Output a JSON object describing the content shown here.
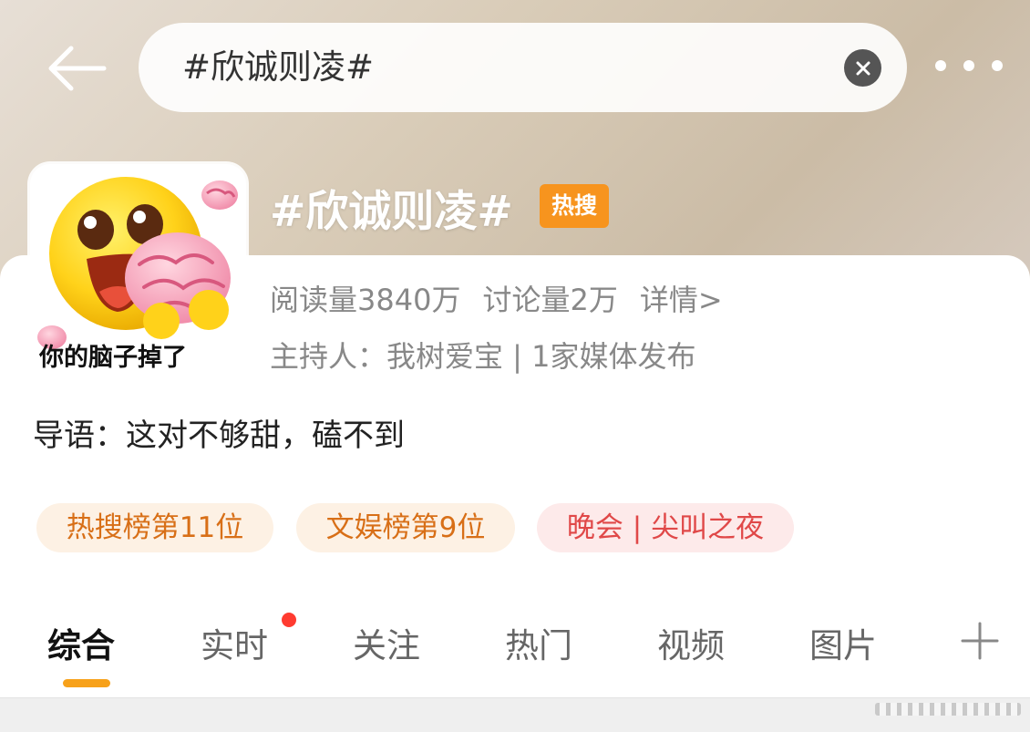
{
  "header": {
    "search_text": "#欣诚则凌#"
  },
  "topic": {
    "title": "#欣诚则凌#",
    "badge": "热搜",
    "reads": "阅读量3840万",
    "discussions": "讨论量2万",
    "details": "详情>",
    "host": "主持人：我树爱宝 | 1家媒体发布",
    "intro": "导语：这对不够甜，磕不到",
    "avatar_caption": "你的脑子掉了"
  },
  "tags": [
    "热搜榜第11位",
    "文娱榜第9位",
    "晚会 | 尖叫之夜"
  ],
  "tabs": [
    {
      "label": "综合",
      "active": true
    },
    {
      "label": "实时",
      "new_dot": true
    },
    {
      "label": "关注"
    },
    {
      "label": "热门"
    },
    {
      "label": "视频"
    },
    {
      "label": "图片"
    }
  ],
  "colors": {
    "accent": "#f7a11a",
    "hot_badge": "#f7941e",
    "tag_orange": "#d86f17",
    "tag_red": "#e04848",
    "new_dot": "#ff3b30"
  },
  "icons": {
    "back": "back-arrow-icon",
    "clear": "clear-icon",
    "more": "more-icon",
    "add_tab": "plus-icon"
  }
}
